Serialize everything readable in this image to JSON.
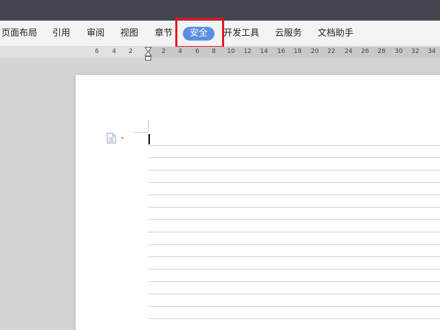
{
  "menu": {
    "items": [
      {
        "label": "页面布局"
      },
      {
        "label": "引用"
      },
      {
        "label": "审阅"
      },
      {
        "label": "视图"
      },
      {
        "label": "章节"
      },
      {
        "label": "安全",
        "active": true
      },
      {
        "label": "开发工具"
      },
      {
        "label": "云服务"
      },
      {
        "label": "文档助手"
      }
    ],
    "active_color": "#5c8fe3",
    "highlight_color": "#e8141e"
  },
  "ruler": {
    "left_ticks": [
      "6",
      "4",
      "2"
    ],
    "right_ticks": [
      "2",
      "4",
      "6",
      "8",
      "10",
      "12",
      "14",
      "16",
      "18",
      "20",
      "22",
      "24",
      "26",
      "28",
      "30",
      "32",
      "34"
    ]
  },
  "document": {
    "paragraph_icon": "document-icon",
    "dropdown_icon": "small-triangle-down-icon"
  }
}
